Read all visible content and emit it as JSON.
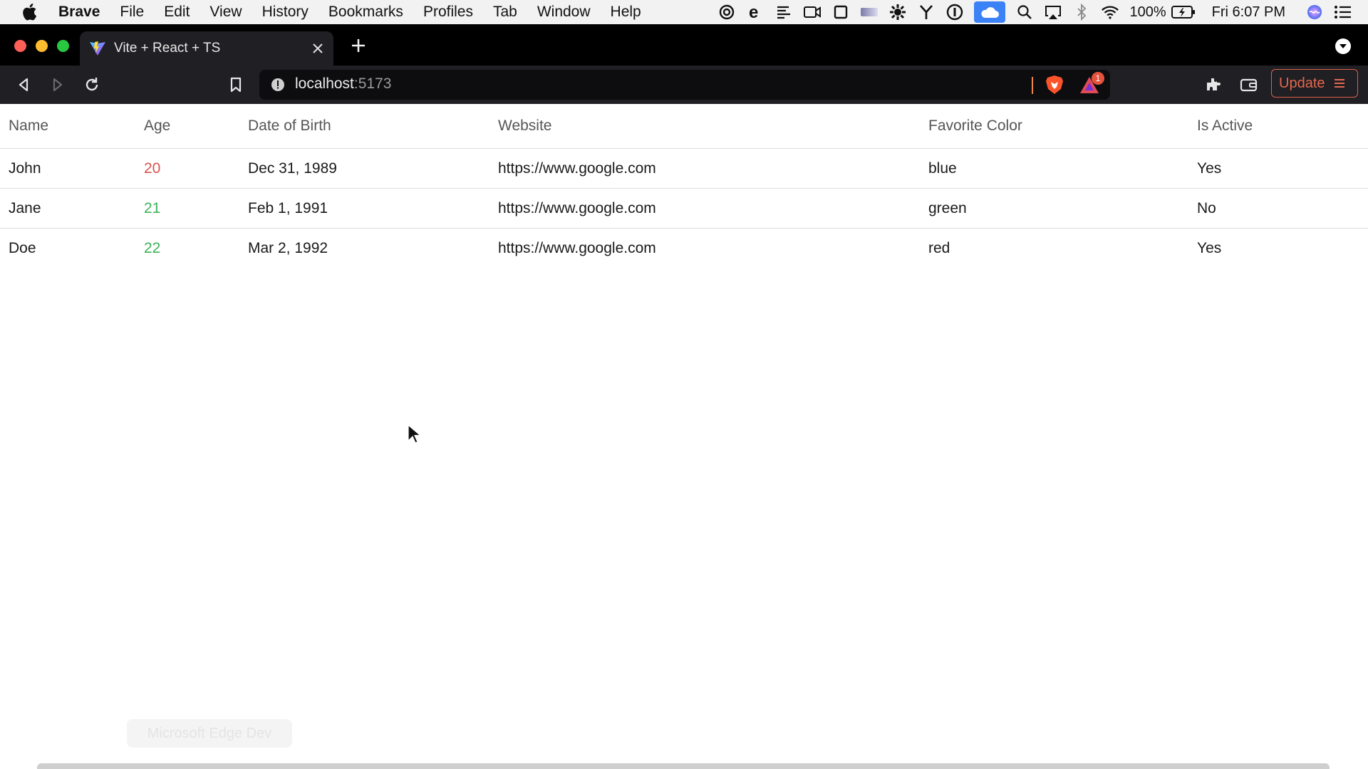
{
  "menubar": {
    "app": "Brave",
    "items": [
      "File",
      "Edit",
      "View",
      "History",
      "Bookmarks",
      "Profiles",
      "Tab",
      "Window",
      "Help"
    ],
    "battery": "100%",
    "clock": "Fri 6:07 PM"
  },
  "tab": {
    "title": "Vite + React + TS"
  },
  "address": {
    "host": "localhost",
    "port": ":5173"
  },
  "rewards_badge": "1",
  "toolbar": {
    "update_label": "Update"
  },
  "table": {
    "headers": [
      "Name",
      "Age",
      "Date of Birth",
      "Website",
      "Favorite Color",
      "Is Active"
    ],
    "rows": [
      {
        "name": "John",
        "age": "20",
        "dob": "Dec 31, 1989",
        "website": "https://www.google.com",
        "color": "blue",
        "active": "Yes"
      },
      {
        "name": "Jane",
        "age": "21",
        "dob": "Feb 1, 1991",
        "website": "https://www.google.com",
        "color": "green",
        "active": "No"
      },
      {
        "name": "Doe",
        "age": "22",
        "dob": "Mar 2, 1992",
        "website": "https://www.google.com",
        "color": "red",
        "active": "Yes"
      }
    ]
  },
  "dock_tooltip": "Microsoft Edge Dev",
  "colors": {
    "age_low": "#d9534f",
    "age_high": "#3db35a",
    "accent": "#e6684f"
  }
}
